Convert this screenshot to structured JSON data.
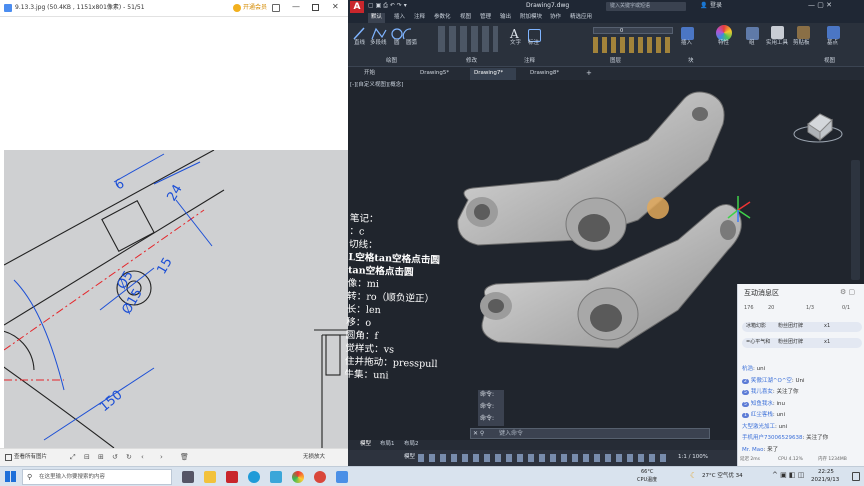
{
  "viewer": {
    "title": "9.13.3.jpg (50.4KB , 1151x801像素) - 51/51",
    "open_label": "开通会员",
    "bottom_label": "查看所有图片",
    "zoom_label": "无损放大",
    "dims": {
      "d6": "6",
      "d24": "24",
      "d15": "15",
      "phi5": "Ø5",
      "phi15": "Ø15",
      "d150": "150"
    }
  },
  "cad": {
    "app_letter": "A",
    "title": "Drawing7.dwg",
    "search_placeholder": "键入关键字或短语",
    "login_label": "登录",
    "ribbon_tabs": [
      "默认",
      "插入",
      "注释",
      "参数化",
      "视图",
      "管理",
      "输出",
      "附加模块",
      "协作",
      "精选应用"
    ],
    "active_ribbon_tab": "默认",
    "ribbon_groups": [
      "直线",
      "多段线",
      "圆",
      "圆弧",
      "文字",
      "标注",
      "插入",
      "特性",
      "组",
      "实用工具",
      "剪贴板",
      "基点"
    ],
    "panel_labels": [
      "绘图",
      "修改",
      "注释",
      "图层",
      "块",
      "视图"
    ],
    "layer_value": "0",
    "doc_tabs": [
      "开始",
      "Drawing5*",
      "Drawing7*",
      "Drawing8*"
    ],
    "active_doc_tab": "Drawing7*",
    "viewport_label": "[-][自定义视图][概念]",
    "notes": [
      "笔记：",
      "：c",
      "切线：",
      "L空格tan空格点击圆",
      "tan空格点击圆",
      "像：mi",
      "转：ro（顺负逆正）",
      "长：len",
      "移：o",
      "圆角：f",
      "觉样式：vs",
      "住并拖动：presspull",
      "牛集：uni"
    ],
    "cmd_history": [
      "命令:",
      "命令:",
      "命令:"
    ],
    "cmd_placeholder": "键入命令",
    "layout_tabs": [
      "模型",
      "布局1",
      "布局2"
    ],
    "status_model": "模型",
    "status_scale": "1:1 / 100%"
  },
  "chat": {
    "title": "互动消息区",
    "stats": [
      "176",
      "20",
      "1/3",
      "0/1"
    ],
    "gifts": [
      {
        "user": "冰箱幻影",
        "text": "粉丝团灯牌",
        "count": "x1"
      },
      {
        "user": "=心平气和",
        "text": "粉丝团灯牌",
        "count": "x1"
      }
    ],
    "messages": [
      {
        "user": "杭浩",
        "level": "",
        "text": "uni"
      },
      {
        "user": "笑傲江湖^O^空",
        "level": "2",
        "text": "Uni"
      },
      {
        "user": "我儿喜女",
        "level": "5",
        "text": "关注了你"
      },
      {
        "user": "知鱼我水",
        "level": "5",
        "text": "inu"
      },
      {
        "user": "红尘客栈",
        "level": "1",
        "text": "uni"
      },
      {
        "user": "大型激光加工",
        "level": "",
        "text": "uni"
      },
      {
        "user": "手机用户73006529638",
        "level": "",
        "text": "关注了你"
      },
      {
        "user": "Mr. Mao",
        "level": "",
        "text": "来了"
      }
    ],
    "footer": [
      "延迟 2ms",
      "CPU 4.12%",
      "内存 1234MB"
    ]
  },
  "taskbar": {
    "search_placeholder": "在这里输入你要搜索的内容",
    "cpu_temp": "66°C",
    "cpu_label": "CPU温度",
    "weather": "27°C 空气优 34",
    "time": "22:25",
    "date": "2021/9/13"
  },
  "colors": {
    "dim_blue": "#1c4fd6",
    "center_red": "#e5252a",
    "part_gray": "#b8b8b8",
    "cad_bg": "#20252d"
  }
}
